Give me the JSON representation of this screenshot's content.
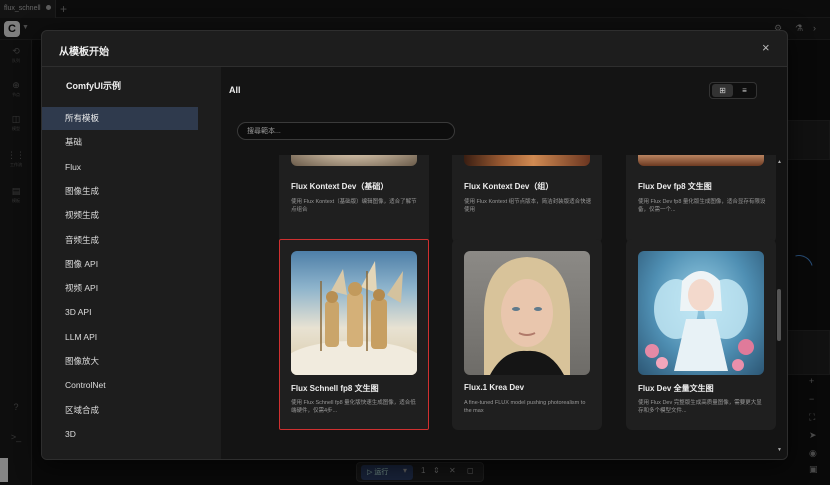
{
  "app": {
    "tab_title": "flux_schnell",
    "tab_add": "+",
    "logo_letter": "C"
  },
  "left_bar": {
    "items": [
      {
        "icon": "history-icon",
        "glyph": "⟲",
        "label": "队列"
      },
      {
        "icon": "node-library-icon",
        "glyph": "⊕",
        "label": "节点"
      },
      {
        "icon": "model-library-icon",
        "glyph": "◫",
        "label": "模型"
      },
      {
        "icon": "workflows-icon",
        "glyph": "⋮⋮",
        "label": "工作流"
      },
      {
        "icon": "templates-icon",
        "glyph": "▤",
        "label": "模板"
      }
    ],
    "bottom_icons": [
      {
        "icon": "help-icon",
        "glyph": "?"
      },
      {
        "icon": "terminal-icon",
        "glyph": ">_"
      }
    ]
  },
  "modal": {
    "title": "从模板开始",
    "close_glyph": "×",
    "sidebar_heading": "ComfyUI示例",
    "categories": [
      {
        "label": "所有模板",
        "active": true
      },
      {
        "label": "基础"
      },
      {
        "label": "Flux"
      },
      {
        "label": "图像生成"
      },
      {
        "label": "视频生成"
      },
      {
        "label": "音频生成"
      },
      {
        "label": "图像 API"
      },
      {
        "label": "视频 API"
      },
      {
        "label": "3D API"
      },
      {
        "label": "LLM API"
      },
      {
        "label": "图像放大"
      },
      {
        "label": "ControlNet"
      },
      {
        "label": "区域合成"
      },
      {
        "label": "3D"
      }
    ],
    "main_title": "All",
    "view_toggle": {
      "grid_glyph": "⊞",
      "list_glyph": "≡"
    },
    "search_placeholder": "搜尋範本...",
    "cards_row1": [
      {
        "title": "Flux Kontext Dev（基础）",
        "desc": "使用 Flux Kontext（基础版）编辑图像，适合了解节点组合"
      },
      {
        "title": "Flux Kontext Dev（组）",
        "desc": "使用 Flux Kontext 组节点版本，简洁封装版适合快速使用"
      },
      {
        "title": "Flux Dev fp8 文生图",
        "desc": "使用 Flux Dev fp8 量化版生成图像，适合显存有限设备，仅需一个..."
      }
    ],
    "cards_row2": [
      {
        "title": "Flux Schnell fp8 文生图",
        "desc": "使用 Flux Schnell fp8 量化版快速生成图像，适合低端硬件，仅需4步..."
      },
      {
        "title": "Flux.1 Krea Dev",
        "desc": "A fine-tuned FLUX model pushing photorealism to the max"
      },
      {
        "title": "Flux Dev 全量文生图",
        "desc": "使用 Flux Dev 完整版生成高质量图像，需要更大显存和多个模型文件..."
      }
    ]
  },
  "bottom_toolbar": {
    "run_label": "运行",
    "count": "1"
  },
  "colors": {
    "accent": "#2f3a4d",
    "highlight": "#d03030",
    "link_curve": "#4a8fdc"
  }
}
